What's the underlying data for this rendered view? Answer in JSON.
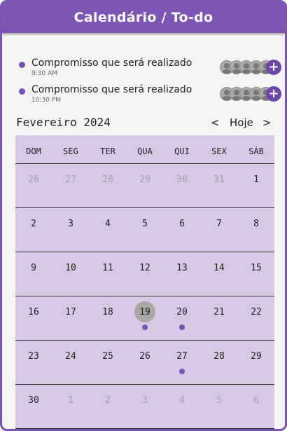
{
  "header": {
    "title": "Calendário / To-do"
  },
  "tasks": [
    {
      "title": "Compromisso que será realizado",
      "time": "9:30 AM",
      "add_label": "+"
    },
    {
      "title": "Compromisso que será realizado",
      "time": "10:30 PM",
      "add_label": "+"
    }
  ],
  "calendar": {
    "month_label": "Fevereiro 2024",
    "prev_label": "<",
    "today_label": "Hoje",
    "next_label": ">",
    "weekdays": [
      "DOM",
      "SEG",
      "TER",
      "QUA",
      "QUI",
      "SEX",
      "SÁB"
    ],
    "weeks": [
      [
        {
          "d": "26",
          "muted": true
        },
        {
          "d": "27",
          "muted": true
        },
        {
          "d": "28",
          "muted": true
        },
        {
          "d": "29",
          "muted": true
        },
        {
          "d": "30",
          "muted": true
        },
        {
          "d": "31",
          "muted": true
        },
        {
          "d": "1"
        }
      ],
      [
        {
          "d": "2"
        },
        {
          "d": "3"
        },
        {
          "d": "4"
        },
        {
          "d": "5"
        },
        {
          "d": "6"
        },
        {
          "d": "7"
        },
        {
          "d": "8"
        }
      ],
      [
        {
          "d": "9"
        },
        {
          "d": "10"
        },
        {
          "d": "11"
        },
        {
          "d": "12"
        },
        {
          "d": "13"
        },
        {
          "d": "14"
        },
        {
          "d": "15"
        }
      ],
      [
        {
          "d": "16"
        },
        {
          "d": "17"
        },
        {
          "d": "18"
        },
        {
          "d": "19",
          "today": true,
          "event": true
        },
        {
          "d": "20",
          "event": true
        },
        {
          "d": "21"
        },
        {
          "d": "22"
        }
      ],
      [
        {
          "d": "23"
        },
        {
          "d": "24"
        },
        {
          "d": "25"
        },
        {
          "d": "26"
        },
        {
          "d": "27",
          "event": true
        },
        {
          "d": "28"
        },
        {
          "d": "29"
        }
      ],
      [
        {
          "d": "30"
        },
        {
          "d": "1",
          "muted": true
        },
        {
          "d": "2",
          "muted": true
        },
        {
          "d": "3",
          "muted": true
        },
        {
          "d": "4",
          "muted": true
        },
        {
          "d": "5",
          "muted": true
        },
        {
          "d": "6",
          "muted": true
        }
      ]
    ]
  },
  "colors": {
    "accent": "#7c55b5",
    "calendar_bg": "#d8c8e4",
    "today_circle": "#a9a6a6"
  }
}
